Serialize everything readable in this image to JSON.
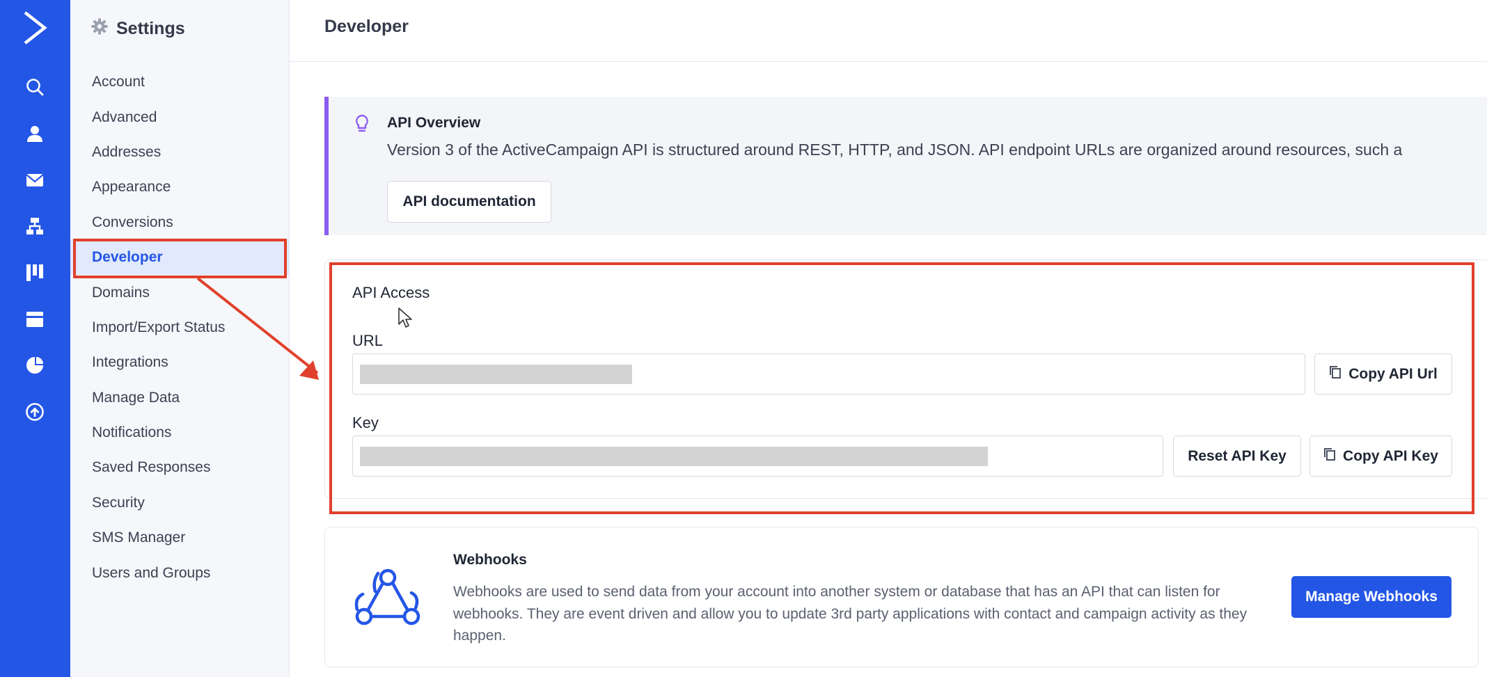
{
  "settings": {
    "title": "Settings",
    "menu": [
      {
        "label": "Account"
      },
      {
        "label": "Advanced"
      },
      {
        "label": "Addresses"
      },
      {
        "label": "Appearance"
      },
      {
        "label": "Conversions"
      },
      {
        "label": "Developer",
        "active": true
      },
      {
        "label": "Domains"
      },
      {
        "label": "Import/Export Status"
      },
      {
        "label": "Integrations"
      },
      {
        "label": "Manage Data"
      },
      {
        "label": "Notifications"
      },
      {
        "label": "Saved Responses"
      },
      {
        "label": "Security"
      },
      {
        "label": "SMS Manager"
      },
      {
        "label": "Users and Groups"
      }
    ]
  },
  "header": {
    "title": "Developer"
  },
  "overview": {
    "title": "API Overview",
    "text": "Version 3 of the ActiveCampaign API is structured around REST, HTTP, and JSON. API endpoint URLs are organized around resources, such a",
    "doc_button": "API documentation"
  },
  "api_access": {
    "title": "API Access",
    "url_label": "URL",
    "key_label": "Key",
    "copy_url_button": "Copy API Url",
    "reset_key_button": "Reset API Key",
    "copy_key_button": "Copy API Key"
  },
  "webhooks": {
    "title": "Webhooks",
    "description": "Webhooks are used to send data from your account into another system or database that has an API that can listen for webhooks. They are event driven and allow you to update 3rd party applications with contact and campaign activity as they happen.",
    "button": "Manage Webhooks"
  },
  "colors": {
    "rail": "#2456e6",
    "accent": "#2456e6",
    "overview_border": "#8a5cf0",
    "annotation": "#e0412c",
    "active_item_bg": "#e1e9fc"
  },
  "rail_icons": [
    "logo-icon",
    "search-icon",
    "contacts-icon",
    "campaigns-icon",
    "automations-icon",
    "deals-icon",
    "site-icon",
    "reports-icon",
    "upgrade-icon"
  ]
}
